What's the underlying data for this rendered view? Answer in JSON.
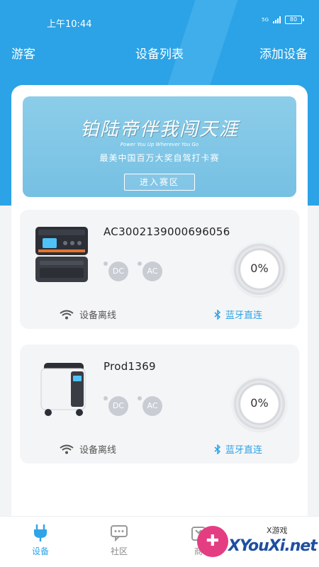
{
  "status_bar": {
    "time": "上午10:44",
    "network": "5G",
    "battery": "80"
  },
  "nav": {
    "left": "游客",
    "title": "设备列表",
    "right": "添加设备"
  },
  "banner": {
    "headline": "铂陆帝伴我闯天涯",
    "tagline_en": "Power You Up Wherever You Go",
    "subtitle": "最美中国百万大奖自驾打卡赛",
    "button": "进入赛区"
  },
  "devices": [
    {
      "name": "AC3002139000696056",
      "ports": [
        "DC",
        "AC"
      ],
      "percent": "0%",
      "wifi_status": "设备离线",
      "bluetooth": "蓝牙直连",
      "image_icon": "portable-power-station-stack"
    },
    {
      "name": "Prod1369",
      "ports": [
        "DC",
        "AC"
      ],
      "percent": "0%",
      "wifi_status": "设备离线",
      "bluetooth": "蓝牙直连",
      "image_icon": "portable-power-station-wheeled"
    }
  ],
  "tabbar": {
    "items": [
      {
        "label": "设备",
        "icon": "plug-icon",
        "active": true
      },
      {
        "label": "社区",
        "icon": "chat-icon",
        "active": false
      },
      {
        "label": "商",
        "icon": "shop-icon",
        "active": false
      }
    ]
  },
  "watermark": {
    "logo_text": "XYouXi.net",
    "tag": "X游戏"
  },
  "colors": {
    "primary": "#2ba3e6",
    "bluetooth": "#2fa4e7",
    "port_gray": "#c9ccd3",
    "card_bg": "#f4f5f7"
  }
}
